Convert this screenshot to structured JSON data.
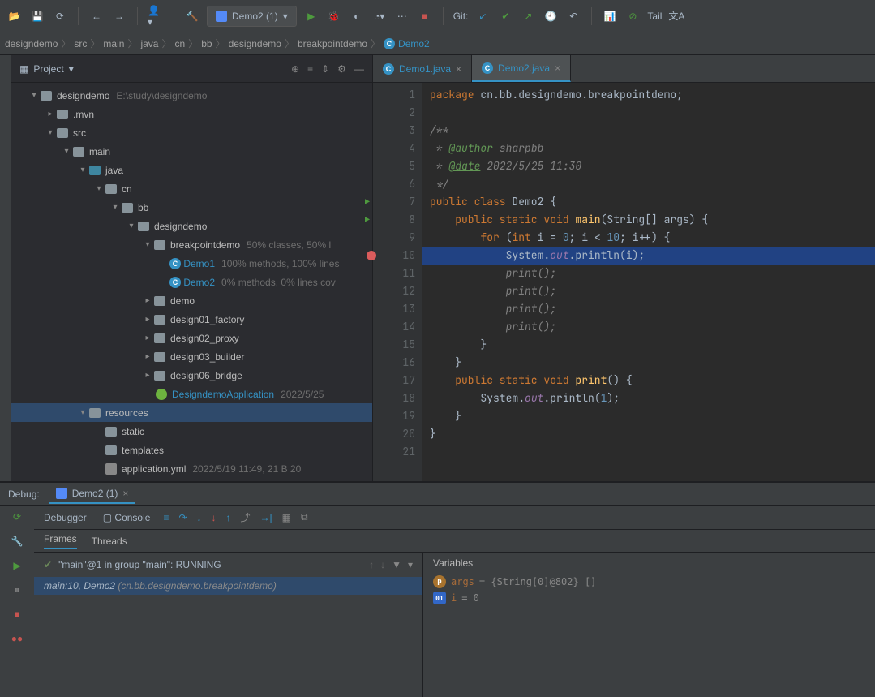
{
  "toolbar": {
    "run_config": "Demo2 (1)",
    "git_label": "Git:",
    "tail_label": "Tail"
  },
  "breadcrumb": [
    "designdemo",
    "src",
    "main",
    "java",
    "cn",
    "bb",
    "designdemo",
    "breakpointdemo",
    "Demo2"
  ],
  "project": {
    "title": "Project",
    "root": "designdemo",
    "root_path": "E:\\study\\designdemo",
    "mvn": ".mvn",
    "src": "src",
    "main_item": "main",
    "java": "java",
    "cn": "cn",
    "bb": "bb",
    "designdemo": "designdemo",
    "breakpointdemo": "breakpointdemo",
    "breakpointdemo_meta": "50% classes, 50% l",
    "demo1": "Demo1",
    "demo1_meta": "100% methods, 100% lines",
    "demo2": "Demo2",
    "demo2_meta": "0% methods, 0% lines cov",
    "demo": "demo",
    "d1": "design01_factory",
    "d2": "design02_proxy",
    "d3": "design03_builder",
    "d4": "design06_bridge",
    "app": "DesigndemoApplication",
    "app_meta": "2022/5/25",
    "resources": "resources",
    "static_dir": "static",
    "templates": "templates",
    "appyml": "application.yml",
    "appyml_meta": "2022/5/19 11:49, 21 B 20"
  },
  "editor": {
    "tabs": [
      {
        "label": "Demo1.java"
      },
      {
        "label": "Demo2.java"
      }
    ],
    "lines": {
      "l1_pkg_kw": "package",
      "l1_pkg": " cn.bb.designdemo.breakpointdemo",
      "l3": "/**",
      "l4_tag": "@author",
      "l4_txt": " sharpbb",
      "l5_tag": "@date",
      "l5_txt": " 2022/5/25 11:30",
      "l6": " */",
      "l7_public": "public class ",
      "l7_cls": "Demo2",
      "l8": "public static void ",
      "l8_main": "main",
      "l8_rest": "(String[] args) {",
      "l9_for": "for ",
      "l9_int": "int",
      "l9_rest1": " i = ",
      "l9_zero": "0",
      "l9_rest2": "; i < ",
      "l9_ten": "10",
      "l9_rest3": "; i++) {",
      "l10_a": "System.",
      "l10_out": "out",
      "l10_b": ".println(i);",
      "l11": "print();",
      "l12": "print();",
      "l13": "print();",
      "l14": "print();",
      "l15": "}",
      "l16": "}",
      "l17": "public static void ",
      "l17_m": "print",
      "l17_r": "() {",
      "l18_a": "System.",
      "l18_out": "out",
      "l18_b": ".println(",
      "l18_one": "1",
      "l18_c": ");",
      "l19": "}",
      "l20": "}"
    }
  },
  "debug": {
    "label": "Debug:",
    "tab": "Demo2 (1)",
    "debugger": "Debugger",
    "console": "Console",
    "frames": "Frames",
    "threads": "Threads",
    "thread_line": "\"main\"@1 in group \"main\": RUNNING",
    "stack_a": "main:10, Demo2 ",
    "stack_b": "(cn.bb.designdemo.breakpointdemo)",
    "variables": "Variables",
    "var1_name": "args",
    "var1_val": " = {String[0]@802} []",
    "var2_name": "i",
    "var2_val": " = 0"
  }
}
